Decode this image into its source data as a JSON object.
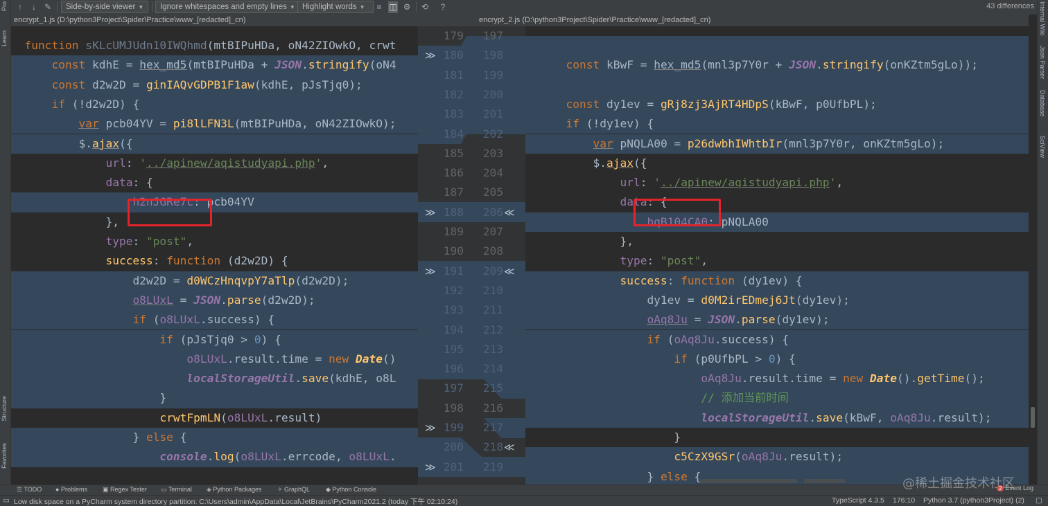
{
  "toolbar": {
    "up_icon": "↑",
    "down_icon": "↓",
    "edit_icon": "✎",
    "viewer_mode": "Side-by-side viewer",
    "whitespace_mode": "Ignore whitespaces and empty lines",
    "highlight_mode": "Highlight words",
    "differences_count": "43 differences"
  },
  "left_file": {
    "path": "encrypt_1.js (D:\\python3Project\\Spider\\Practice\\www_[redacted]_cn)"
  },
  "right_file": {
    "path": "encrypt_2.js (D:\\python3Project\\Spider\\Practice\\www_[redacted]_cn)"
  },
  "left_side_tabs": [
    "Pro",
    "Learn",
    "Structure",
    "Favorites"
  ],
  "right_side_tabs": [
    "Internal Wiki",
    "Json Parser",
    "Database",
    "SciView"
  ],
  "gutter_rows": [
    {
      "left": "179",
      "right": "197"
    },
    {
      "left": "180",
      "right": "198"
    },
    {
      "left": "181",
      "right": "199"
    },
    {
      "left": "182",
      "right": "200"
    },
    {
      "left": "183",
      "right": "201"
    },
    {
      "left": "184",
      "right": "202"
    },
    {
      "left": "185",
      "right": "203"
    },
    {
      "left": "186",
      "right": "204"
    },
    {
      "left": "187",
      "right": "205"
    },
    {
      "left": "188",
      "right": "206"
    },
    {
      "left": "189",
      "right": "207"
    },
    {
      "left": "190",
      "right": "208"
    },
    {
      "left": "191",
      "right": "209"
    },
    {
      "left": "192",
      "right": "210"
    },
    {
      "left": "193",
      "right": "211"
    },
    {
      "left": "194",
      "right": "212"
    },
    {
      "left": "195",
      "right": "213"
    },
    {
      "left": "196",
      "right": "214"
    },
    {
      "left": "197",
      "right": "215"
    },
    {
      "left": "198",
      "right": "216"
    },
    {
      "left": "199",
      "right": "217"
    },
    {
      "left": "200",
      "right": "218"
    },
    {
      "left": "201",
      "right": "219"
    }
  ],
  "left_code": [
    {
      "indent": "",
      "tokens": [
        {
          "c": "kw",
          "t": "function "
        },
        {
          "c": "fn dim",
          "t": "sKLcUMJUdn10IWQhmd"
        },
        {
          "c": "",
          "t": "(mtBIPuHDa, oN42ZIOwkO, crwt"
        }
      ]
    },
    {
      "indent": "    ",
      "tokens": [
        {
          "c": "kw",
          "t": "const "
        },
        {
          "c": "",
          "t": "kdhE = "
        },
        {
          "c": "ul",
          "t": "hex_md5"
        },
        {
          "c": "",
          "t": "(mtBIPuHDa + "
        },
        {
          "c": "bjs",
          "t": "JSON"
        },
        {
          "c": "",
          "t": "."
        },
        {
          "c": "fn",
          "t": "stringify"
        },
        {
          "c": "",
          "t": "(oN4"
        }
      ]
    },
    {
      "indent": "    ",
      "tokens": [
        {
          "c": "kw",
          "t": "const "
        },
        {
          "c": "",
          "t": "d2w2D = "
        },
        {
          "c": "fn",
          "t": "ginIAQvGDPB1F1aw"
        },
        {
          "c": "",
          "t": "(kdhE, pJsTjq0);"
        }
      ]
    },
    {
      "indent": "    ",
      "tokens": [
        {
          "c": "kw",
          "t": "if "
        },
        {
          "c": "",
          "t": "(!d2w2D) {"
        }
      ]
    },
    {
      "indent": "        ",
      "tokens": [
        {
          "c": "kw ul",
          "t": "var"
        },
        {
          "c": "",
          "t": " pcb04YV = "
        },
        {
          "c": "fn",
          "t": "pi8lLFN3L"
        },
        {
          "c": "",
          "t": "(mtBIPuHDa, oN42ZIOwkO);"
        }
      ]
    },
    {
      "indent": "        ",
      "tokens": [
        {
          "c": "",
          "t": "$."
        },
        {
          "c": "fn ul",
          "t": "ajax"
        },
        {
          "c": "",
          "t": "({"
        }
      ]
    },
    {
      "indent": "            ",
      "tokens": [
        {
          "c": "prop",
          "t": "url"
        },
        {
          "c": "",
          "t": ": "
        },
        {
          "c": "str",
          "t": "'"
        },
        {
          "c": "str ul",
          "t": "../apinew/aqistudyapi.php"
        },
        {
          "c": "str",
          "t": "'"
        },
        {
          "c": "",
          "t": ","
        }
      ]
    },
    {
      "indent": "            ",
      "tokens": [
        {
          "c": "prop",
          "t": "data"
        },
        {
          "c": "",
          "t": ": {"
        }
      ]
    },
    {
      "indent": "                ",
      "tokens": [
        {
          "c": "prop",
          "t": "h2nJGRe7c"
        },
        {
          "c": "",
          "t": ": pcb04YV"
        }
      ]
    },
    {
      "indent": "            ",
      "tokens": [
        {
          "c": "",
          "t": "},"
        }
      ]
    },
    {
      "indent": "            ",
      "tokens": [
        {
          "c": "prop",
          "t": "type"
        },
        {
          "c": "",
          "t": ": "
        },
        {
          "c": "str",
          "t": "\"post\""
        },
        {
          "c": "",
          "t": ","
        }
      ]
    },
    {
      "indent": "            ",
      "tokens": [
        {
          "c": "fn",
          "t": "success"
        },
        {
          "c": "",
          "t": ": "
        },
        {
          "c": "kw",
          "t": "function "
        },
        {
          "c": "",
          "t": "(d2w2D) {"
        }
      ]
    },
    {
      "indent": "                ",
      "tokens": [
        {
          "c": "",
          "t": "d2w2D = "
        },
        {
          "c": "fn",
          "t": "d0WCzHnqvpY7aTlp"
        },
        {
          "c": "",
          "t": "(d2w2D);"
        }
      ]
    },
    {
      "indent": "                ",
      "tokens": [
        {
          "c": "prop ul",
          "t": "o8LUxL"
        },
        {
          "c": "",
          "t": " = "
        },
        {
          "c": "bjs",
          "t": "JSON"
        },
        {
          "c": "",
          "t": "."
        },
        {
          "c": "fn",
          "t": "parse"
        },
        {
          "c": "",
          "t": "(d2w2D);"
        }
      ]
    },
    {
      "indent": "                ",
      "tokens": [
        {
          "c": "kw",
          "t": "if "
        },
        {
          "c": "",
          "t": "("
        },
        {
          "c": "prop",
          "t": "o8LUxL"
        },
        {
          "c": "",
          "t": ".success) {"
        }
      ]
    },
    {
      "indent": "                    ",
      "tokens": [
        {
          "c": "kw",
          "t": "if "
        },
        {
          "c": "",
          "t": "(pJsTjq0 > "
        },
        {
          "c": "num",
          "t": "0"
        },
        {
          "c": "",
          "t": ") {"
        }
      ]
    },
    {
      "indent": "                        ",
      "tokens": [
        {
          "c": "prop",
          "t": "o8LUxL"
        },
        {
          "c": "",
          "t": ".result.time = "
        },
        {
          "c": "kw",
          "t": "new "
        },
        {
          "c": "bdim fn",
          "t": "Date"
        },
        {
          "c": "",
          "t": "()"
        }
      ]
    },
    {
      "indent": "                        ",
      "tokens": [
        {
          "c": "bjs",
          "t": "localStorageUtil"
        },
        {
          "c": "",
          "t": "."
        },
        {
          "c": "fn",
          "t": "save"
        },
        {
          "c": "",
          "t": "(kdhE, o8L"
        }
      ]
    },
    {
      "indent": "                    ",
      "tokens": [
        {
          "c": "",
          "t": "}"
        }
      ]
    },
    {
      "indent": "                    ",
      "tokens": [
        {
          "c": "fn",
          "t": "crwtFpmLN"
        },
        {
          "c": "",
          "t": "("
        },
        {
          "c": "prop",
          "t": "o8LUxL"
        },
        {
          "c": "",
          "t": ".result)"
        }
      ]
    },
    {
      "indent": "                ",
      "tokens": [
        {
          "c": "",
          "t": "} "
        },
        {
          "c": "kw",
          "t": "else "
        },
        {
          "c": "",
          "t": "{"
        }
      ]
    },
    {
      "indent": "                    ",
      "tokens": [
        {
          "c": "bjs",
          "t": "console"
        },
        {
          "c": "",
          "t": "."
        },
        {
          "c": "fn",
          "t": "log"
        },
        {
          "c": "",
          "t": "("
        },
        {
          "c": "prop",
          "t": "o8LUxL"
        },
        {
          "c": "",
          "t": ".errcode, "
        },
        {
          "c": "prop",
          "t": "o8LUxL"
        },
        {
          "c": "",
          "t": "."
        }
      ]
    }
  ],
  "right_code": [
    {
      "indent": "",
      "tokens": []
    },
    {
      "indent": "    ",
      "tokens": [
        {
          "c": "kw",
          "t": "const "
        },
        {
          "c": "",
          "t": "kBwF = "
        },
        {
          "c": "ul",
          "t": "hex_md5"
        },
        {
          "c": "",
          "t": "(mnl3p7Y0r + "
        },
        {
          "c": "bjs",
          "t": "JSON"
        },
        {
          "c": "",
          "t": "."
        },
        {
          "c": "fn",
          "t": "stringify"
        },
        {
          "c": "",
          "t": "(onKZtm5gLo));"
        }
      ]
    },
    {
      "indent": "",
      "tokens": []
    },
    {
      "indent": "    ",
      "tokens": [
        {
          "c": "kw",
          "t": "const "
        },
        {
          "c": "",
          "t": "dy1ev = "
        },
        {
          "c": "fn",
          "t": "gRj8zj3AjRT4HDpS"
        },
        {
          "c": "",
          "t": "(kBwF, p0UfbPL);"
        }
      ]
    },
    {
      "indent": "    ",
      "tokens": [
        {
          "c": "kw",
          "t": "if "
        },
        {
          "c": "",
          "t": "(!dy1ev) {"
        }
      ]
    },
    {
      "indent": "        ",
      "tokens": [
        {
          "c": "kw ul",
          "t": "var"
        },
        {
          "c": "",
          "t": " pNQLA00 = "
        },
        {
          "c": "fn",
          "t": "p26dwbhIWhtbIr"
        },
        {
          "c": "",
          "t": "(mnl3p7Y0r, onKZtm5gLo);"
        }
      ]
    },
    {
      "indent": "        ",
      "tokens": [
        {
          "c": "",
          "t": "$."
        },
        {
          "c": "fn ul",
          "t": "ajax"
        },
        {
          "c": "",
          "t": "({"
        }
      ]
    },
    {
      "indent": "            ",
      "tokens": [
        {
          "c": "prop",
          "t": "url"
        },
        {
          "c": "",
          "t": ": "
        },
        {
          "c": "str",
          "t": "'"
        },
        {
          "c": "str ul",
          "t": "../apinew/aqistudyapi.php"
        },
        {
          "c": "str",
          "t": "'"
        },
        {
          "c": "",
          "t": ","
        }
      ]
    },
    {
      "indent": "            ",
      "tokens": [
        {
          "c": "prop",
          "t": "data"
        },
        {
          "c": "",
          "t": ": {"
        }
      ]
    },
    {
      "indent": "                ",
      "tokens": [
        {
          "c": "prop",
          "t": "hqB104CA0"
        },
        {
          "c": "",
          "t": ": pNQLA00"
        }
      ]
    },
    {
      "indent": "            ",
      "tokens": [
        {
          "c": "",
          "t": "},"
        }
      ]
    },
    {
      "indent": "            ",
      "tokens": [
        {
          "c": "prop",
          "t": "type"
        },
        {
          "c": "",
          "t": ": "
        },
        {
          "c": "str",
          "t": "\"post\""
        },
        {
          "c": "",
          "t": ","
        }
      ]
    },
    {
      "indent": "            ",
      "tokens": [
        {
          "c": "fn",
          "t": "success"
        },
        {
          "c": "",
          "t": ": "
        },
        {
          "c": "kw",
          "t": "function "
        },
        {
          "c": "",
          "t": "(dy1ev) {"
        }
      ]
    },
    {
      "indent": "                ",
      "tokens": [
        {
          "c": "",
          "t": "dy1ev = "
        },
        {
          "c": "fn",
          "t": "d0M2irEDmej6Jt"
        },
        {
          "c": "",
          "t": "(dy1ev);"
        }
      ]
    },
    {
      "indent": "                ",
      "tokens": [
        {
          "c": "prop ul",
          "t": "oAq8Ju"
        },
        {
          "c": "",
          "t": " = "
        },
        {
          "c": "bjs",
          "t": "JSON"
        },
        {
          "c": "",
          "t": "."
        },
        {
          "c": "fn",
          "t": "parse"
        },
        {
          "c": "",
          "t": "(dy1ev);"
        }
      ]
    },
    {
      "indent": "                ",
      "tokens": [
        {
          "c": "kw",
          "t": "if "
        },
        {
          "c": "",
          "t": "("
        },
        {
          "c": "prop",
          "t": "oAq8Ju"
        },
        {
          "c": "",
          "t": ".success) {"
        }
      ]
    },
    {
      "indent": "                    ",
      "tokens": [
        {
          "c": "kw",
          "t": "if "
        },
        {
          "c": "",
          "t": "(p0UfbPL > "
        },
        {
          "c": "num",
          "t": "0"
        },
        {
          "c": "",
          "t": ") {"
        }
      ]
    },
    {
      "indent": "                        ",
      "tokens": [
        {
          "c": "prop",
          "t": "oAq8Ju"
        },
        {
          "c": "",
          "t": ".result.time = "
        },
        {
          "c": "kw",
          "t": "new "
        },
        {
          "c": "bdim fn",
          "t": "Date"
        },
        {
          "c": "",
          "t": "()."
        },
        {
          "c": "fn",
          "t": "getTime"
        },
        {
          "c": "",
          "t": "();"
        }
      ]
    },
    {
      "indent": "                        ",
      "tokens": [
        {
          "c": "cm",
          "t": "// 添加当前时间"
        }
      ]
    },
    {
      "indent": "                        ",
      "tokens": [
        {
          "c": "bjs",
          "t": "localStorageUtil"
        },
        {
          "c": "",
          "t": "."
        },
        {
          "c": "fn",
          "t": "save"
        },
        {
          "c": "",
          "t": "(kBwF, "
        },
        {
          "c": "prop",
          "t": "oAq8Ju"
        },
        {
          "c": "",
          "t": ".result);"
        }
      ]
    },
    {
      "indent": "                    ",
      "tokens": [
        {
          "c": "",
          "t": "}"
        }
      ]
    },
    {
      "indent": "                    ",
      "tokens": [
        {
          "c": "fn",
          "t": "c5CzX9GSr"
        },
        {
          "c": "",
          "t": "("
        },
        {
          "c": "prop",
          "t": "oAq8Ju"
        },
        {
          "c": "",
          "t": ".result);"
        }
      ]
    },
    {
      "indent": "                ",
      "tokens": [
        {
          "c": "",
          "t": "} "
        },
        {
          "c": "kw",
          "t": "else "
        },
        {
          "c": "",
          "t": "{"
        }
      ]
    }
  ],
  "tool_windows": [
    "TODO",
    "Problems",
    "Regex Tester",
    "Terminal",
    "Python Packages",
    "GraphQL",
    "Python Console"
  ],
  "event_log": {
    "badge": "2",
    "label": "Event Log"
  },
  "watermark": "@稀土掘金技术社区",
  "status": {
    "message": "Low disk space on a PyCharm system directory partition: C:\\Users\\admin\\AppData\\Local\\JetBrains\\PyCharm2021.2 (today 下午 02:10:24)",
    "language": "TypeScript 4.3.5",
    "position": "176:10",
    "interpreter": "Python 3.7 (python3Project) (2)"
  }
}
